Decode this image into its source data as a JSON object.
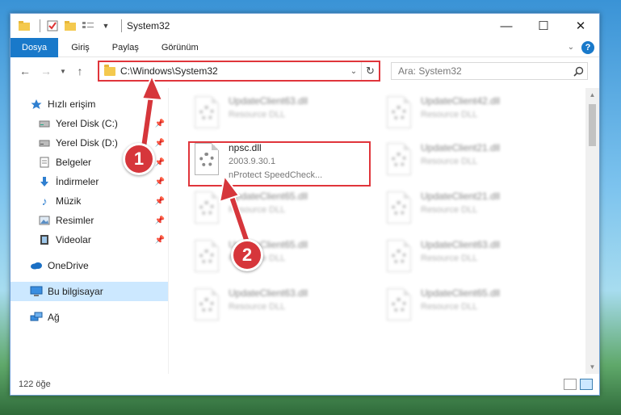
{
  "window": {
    "title": "System32"
  },
  "ribbon": {
    "tabs": [
      "Dosya",
      "Giriş",
      "Paylaş",
      "Görünüm"
    ],
    "help_label": "?"
  },
  "nav": {
    "address": "C:\\Windows\\System32",
    "search_placeholder": "Ara: System32"
  },
  "sidebar": {
    "items": [
      {
        "label": "Hızlı erişim",
        "icon": "star-icon"
      },
      {
        "label": "Yerel Disk (C:)",
        "icon": "drive-icon",
        "pinned": true
      },
      {
        "label": "Yerel Disk (D:)",
        "icon": "drive-icon",
        "pinned": true
      },
      {
        "label": "Belgeler",
        "icon": "documents-icon",
        "pinned": true
      },
      {
        "label": "İndirmeler",
        "icon": "download-icon",
        "pinned": true
      },
      {
        "label": "Müzik",
        "icon": "music-icon",
        "pinned": true
      },
      {
        "label": "Resimler",
        "icon": "pictures-icon",
        "pinned": true
      },
      {
        "label": "Videolar",
        "icon": "videos-icon",
        "pinned": true
      },
      {
        "label": "OneDrive",
        "icon": "cloud-icon"
      },
      {
        "label": "Bu bilgisayar",
        "icon": "computer-icon",
        "selected": true
      },
      {
        "label": "Ağ",
        "icon": "network-icon"
      }
    ]
  },
  "files": [
    {
      "name": "UpdateClient63.dll",
      "sub": "Resource DLL",
      "blur": true
    },
    {
      "name": "UpdateClient42.dll",
      "sub": "Resource DLL",
      "blur": true
    },
    {
      "name": "npsc.dll",
      "sub": "2003.9.30.1",
      "sub2": "nProtect SpeedCheck...",
      "blur": false
    },
    {
      "name": "UpdateClient21.dll",
      "sub": "Resource DLL",
      "blur": true
    },
    {
      "name": "UpdateClient65.dll",
      "sub": "Resource DLL",
      "blur": true
    },
    {
      "name": "UpdateClient21.dll",
      "sub": "Resource DLL",
      "blur": true
    },
    {
      "name": "UpdateClient65.dll",
      "sub": "Resource DLL",
      "blur": true
    },
    {
      "name": "UpdateClient63.dll",
      "sub": "Resource DLL",
      "blur": true
    },
    {
      "name": "UpdateClient63.dll",
      "sub": "Resource DLL",
      "blur": true
    },
    {
      "name": "UpdateClient65.dll",
      "sub": "Resource DLL",
      "blur": true
    }
  ],
  "status": {
    "count": "122 öğe"
  },
  "annotations": {
    "step1": "1",
    "step2": "2",
    "color": "#d6363b"
  }
}
